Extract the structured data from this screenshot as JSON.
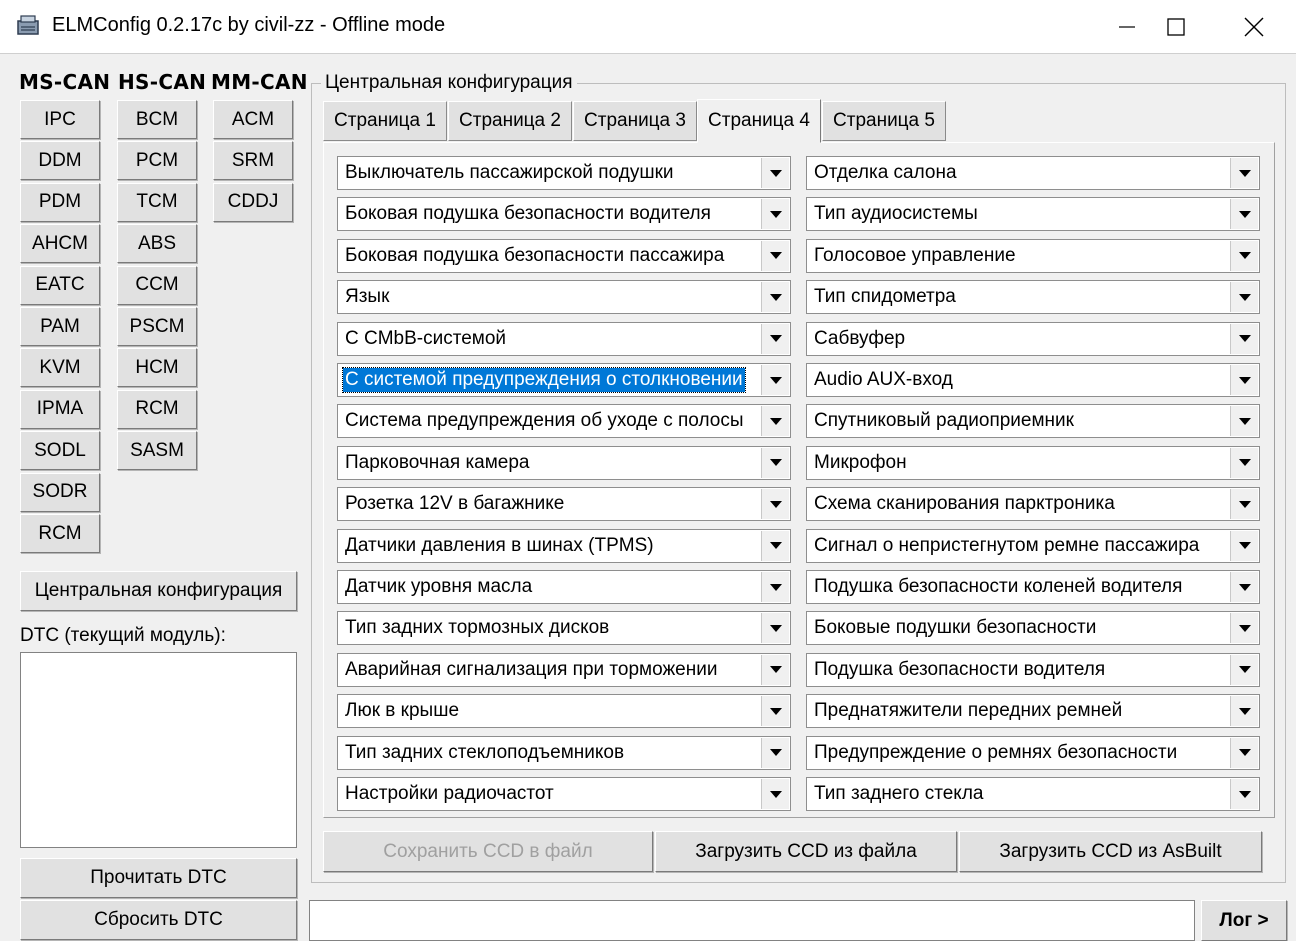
{
  "window": {
    "title": "ELMConfig 0.2.17c by civil-zz - Offline mode",
    "minimize_icon": "minimize-icon",
    "maximize_icon": "maximize-icon",
    "close_icon": "close-icon"
  },
  "buses": {
    "ms_can": {
      "label": "MS-CAN",
      "modules": [
        "IPC",
        "DDM",
        "PDM",
        "AHCM",
        "EATC",
        "PAM",
        "KVM",
        "IPMA",
        "SODL",
        "SODR",
        "RCM"
      ]
    },
    "hs_can": {
      "label": "HS-CAN",
      "modules": [
        "BCM",
        "PCM",
        "TCM",
        "ABS",
        "CCM",
        "PSCM",
        "HCM",
        "RCM",
        "SASM"
      ]
    },
    "mm_can": {
      "label": "MM-CAN",
      "modules": [
        "ACM",
        "SRM",
        "CDDJ"
      ]
    }
  },
  "central_config_button": "Центральная конфигурация",
  "dtc": {
    "label": "DTC (текущий модуль):",
    "read_button": "Прочитать DTC",
    "reset_button": "Сбросить DTC"
  },
  "config_group": {
    "title": "Центральная конфигурация",
    "tabs": [
      "Страница 1",
      "Страница 2",
      "Страница 3",
      "Страница 4",
      "Страница 5"
    ],
    "active_tab": "Страница 4",
    "left_options": [
      "Выключатель пассажирской подушки",
      "Боковая подушка безопасности водителя",
      "Боковая подушка безопасности пассажира",
      "Язык",
      "С CMbB-системой",
      "С системой предупреждения о столкновении",
      "Система предупреждения об уходе с полосы",
      "Парковочная камера",
      "Розетка 12V в багажнике",
      "Датчики давления в шинах (TPMS)",
      "Датчик уровня масла",
      "Тип задних тормозных дисков",
      "Аварийная сигнализация при торможении",
      "Люк в крыше",
      "Тип задних стеклоподъемников",
      "Настройки радиочастот"
    ],
    "right_options": [
      "Отделка салона",
      "Тип аудиосистемы",
      "Голосовое управление",
      "Тип спидометра",
      "Сабвуфер",
      "Audio AUX-вход",
      "Спутниковый радиоприемник",
      "Микрофон",
      "Схема сканирования парктроника",
      "Сигнал о непристегнутом ремне пассажира",
      "Подушка безопасности коленей водителя",
      "Боковые подушки безопасности",
      "Подушка безопасности водителя",
      "Преднатяжители передних ремней",
      "Предупреждение о ремнях безопасности",
      "Тип заднего стекла"
    ],
    "selected_option": "С системой предупреждения о столкновении",
    "save_button": "Сохранить CCD в файл",
    "load_file_button": "Загрузить CCD из файла",
    "load_asbuilt_button": "Загрузить CCD из AsBuilt"
  },
  "log_button": "Лог >"
}
